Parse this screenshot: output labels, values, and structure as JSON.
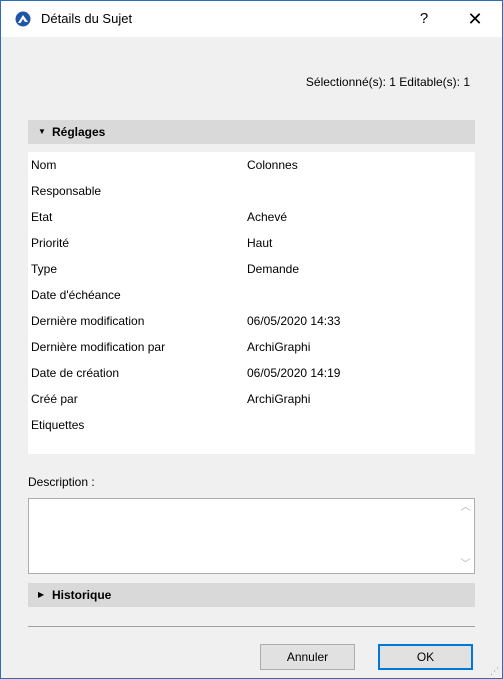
{
  "window": {
    "title": "Détails du Sujet",
    "help_label": "?",
    "close_label": "✕"
  },
  "status": {
    "selection": "Sélectionné(s): 1 Editable(s): 1"
  },
  "settings": {
    "header": "Réglages",
    "rows": [
      {
        "label": "Nom",
        "value": "Colonnes"
      },
      {
        "label": "Responsable",
        "value": ""
      },
      {
        "label": "Etat",
        "value": "Achevé"
      },
      {
        "label": "Priorité",
        "value": "Haut"
      },
      {
        "label": "Type",
        "value": "Demande"
      },
      {
        "label": "Date d'échéance",
        "value": ""
      },
      {
        "label": "Dernière modification",
        "value": "06/05/2020 14:33"
      },
      {
        "label": "Dernière modification par",
        "value": "ArchiGraphi"
      },
      {
        "label": "Date de création",
        "value": "06/05/2020 14:19"
      },
      {
        "label": "Créé par",
        "value": "ArchiGraphi"
      },
      {
        "label": "Etiquettes",
        "value": ""
      }
    ]
  },
  "description": {
    "label": "Description :",
    "value": ""
  },
  "history": {
    "header": "Historique"
  },
  "buttons": {
    "cancel": "Annuler",
    "ok": "OK"
  },
  "colors": {
    "accent": "#0078d7",
    "window_border": "#2b6fb8",
    "panel_header": "#d9d9d9",
    "background": "#f0f0f0"
  },
  "icons": {
    "app": "archicad-app-icon",
    "settings_toggle": "triangle-down-icon",
    "history_toggle": "triangle-right-icon"
  }
}
